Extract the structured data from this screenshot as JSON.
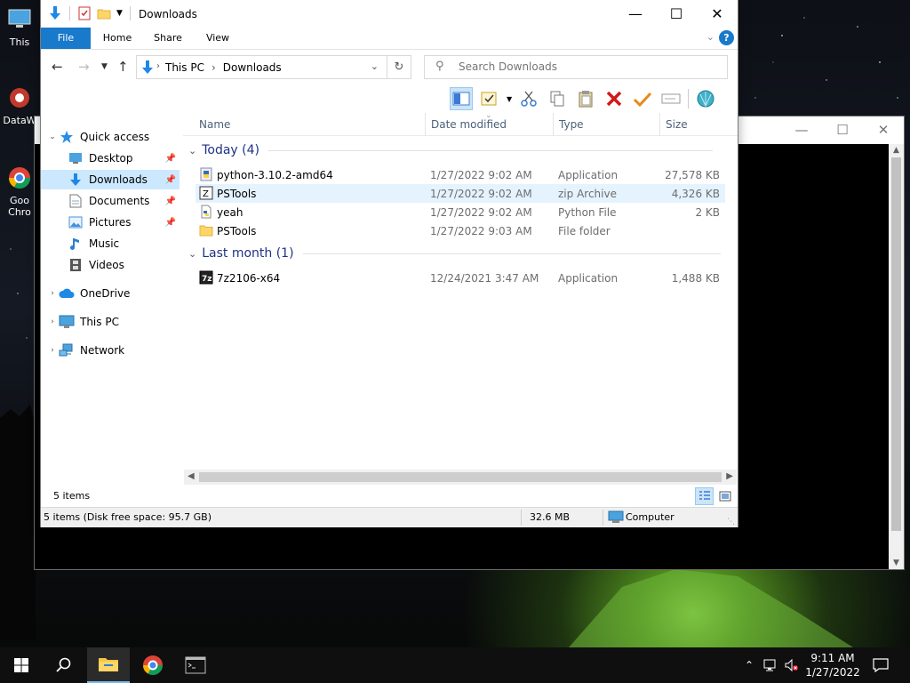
{
  "desktop": {
    "icons": [
      {
        "label": "This"
      },
      {
        "label": "DataW"
      },
      {
        "label": "Goo Chro"
      }
    ]
  },
  "explorer": {
    "title": "Downloads",
    "ribbon_tabs": [
      "File",
      "Home",
      "Share",
      "View"
    ],
    "address": {
      "crumbs": [
        "This PC",
        "Downloads"
      ]
    },
    "search": {
      "placeholder": "Search Downloads"
    },
    "columns": {
      "name": "Name",
      "date": "Date modified",
      "type": "Type",
      "size": "Size"
    },
    "nav": {
      "quick_access": "Quick access",
      "items": [
        {
          "label": "Desktop",
          "pinned": true
        },
        {
          "label": "Downloads",
          "pinned": true,
          "selected": true
        },
        {
          "label": "Documents",
          "pinned": true
        },
        {
          "label": "Pictures",
          "pinned": true
        },
        {
          "label": "Music"
        },
        {
          "label": "Videos"
        }
      ],
      "onedrive": "OneDrive",
      "this_pc": "This PC",
      "network": "Network"
    },
    "groups": [
      {
        "label": "Today (4)",
        "files": [
          {
            "name": "python-3.10.2-amd64",
            "date": "1/27/2022 9:02 AM",
            "type": "Application",
            "size": "27,578 KB",
            "icon": "python-installer-icon"
          },
          {
            "name": "PSTools",
            "date": "1/27/2022 9:02 AM",
            "type": "zip Archive",
            "size": "4,326 KB",
            "icon": "zip-archive-icon",
            "highlighted": true
          },
          {
            "name": "yeah",
            "date": "1/27/2022 9:02 AM",
            "type": "Python File",
            "size": "2 KB",
            "icon": "python-file-icon"
          },
          {
            "name": "PSTools",
            "date": "1/27/2022 9:03 AM",
            "type": "File folder",
            "size": "",
            "icon": "folder-icon"
          }
        ]
      },
      {
        "label": "Last month (1)",
        "files": [
          {
            "name": "7z2106-x64",
            "date": "12/24/2021 3:47 AM",
            "type": "Application",
            "size": "1,488 KB",
            "icon": "7zip-icon"
          }
        ]
      }
    ],
    "status": {
      "item_count": "5 items",
      "info": "5 items (Disk free space: 95.7 GB)",
      "size": "32.6 MB",
      "location": "Computer"
    }
  },
  "taskbar": {
    "time": "9:11 AM",
    "date": "1/27/2022"
  },
  "colors": {
    "accent": "#1979ca",
    "selection": "#cce8ff",
    "group_header": "#1e3287"
  }
}
